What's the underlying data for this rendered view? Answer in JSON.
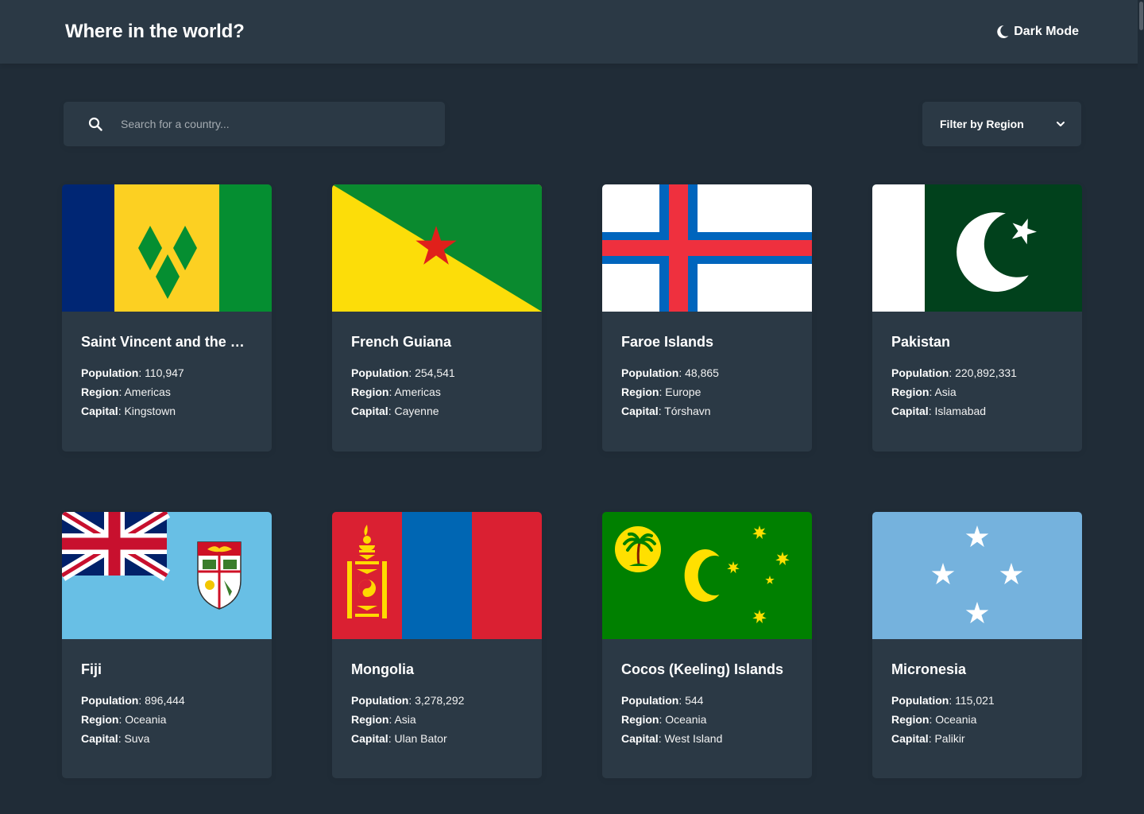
{
  "header": {
    "title": "Where in the world?",
    "mode_toggle": {
      "label": "Dark Mode",
      "icon": "moon-icon"
    }
  },
  "search": {
    "placeholder": "Search for a country...",
    "value": "",
    "icon": "search-icon"
  },
  "filter": {
    "label": "Filter by Region",
    "icon": "chevron-down-icon"
  },
  "labels": {
    "population": "Population",
    "region": "Region",
    "capital": "Capital"
  },
  "colors": {
    "background": "#202c37",
    "elements": "#2b3945",
    "text": "#ffffff"
  },
  "countries": [
    {
      "name": "Saint Vincent and the Gr...",
      "population": "110,947",
      "region": "Americas",
      "capital": "Kingstown"
    },
    {
      "name": "French Guiana",
      "population": "254,541",
      "region": "Americas",
      "capital": "Cayenne"
    },
    {
      "name": "Faroe Islands",
      "population": "48,865",
      "region": "Europe",
      "capital": "Tórshavn"
    },
    {
      "name": "Pakistan",
      "population": "220,892,331",
      "region": "Asia",
      "capital": "Islamabad"
    },
    {
      "name": "Fiji",
      "population": "896,444",
      "region": "Oceania",
      "capital": "Suva"
    },
    {
      "name": "Mongolia",
      "population": "3,278,292",
      "region": "Asia",
      "capital": "Ulan Bator"
    },
    {
      "name": "Cocos (Keeling) Islands",
      "population": "544",
      "region": "Oceania",
      "capital": "West Island"
    },
    {
      "name": "Micronesia",
      "population": "115,021",
      "region": "Oceania",
      "capital": "Palikir"
    }
  ]
}
